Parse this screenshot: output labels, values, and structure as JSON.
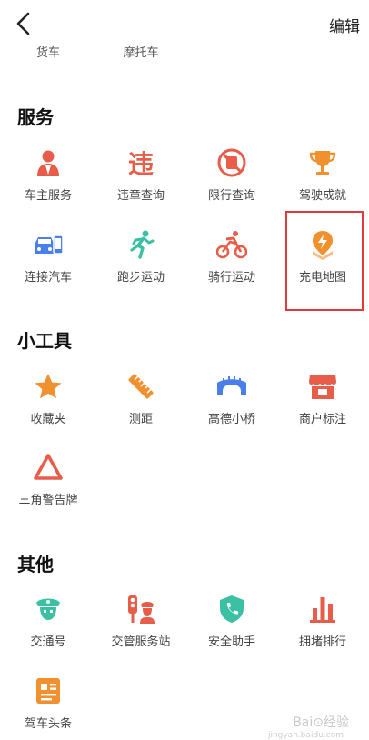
{
  "header": {
    "edit_label": "编辑"
  },
  "top_row": [
    "货车",
    "摩托车"
  ],
  "sections": {
    "services": {
      "title": "服务",
      "items": [
        "车主服务",
        "违章查询",
        "限行查询",
        "驾驶成就",
        "连接汽车",
        "跑步运动",
        "骑行运动",
        "充电地图"
      ]
    },
    "tools": {
      "title": "小工具",
      "items": [
        "收藏夹",
        "测距",
        "高德小桥",
        "商户标注",
        "三角警告牌"
      ]
    },
    "others": {
      "title": "其他",
      "items": [
        "交通号",
        "交管服务站",
        "安全助手",
        "拥堵排行",
        "驾车头条"
      ]
    }
  },
  "violation_glyph": "违",
  "watermark": {
    "text": "Bai⊙经验",
    "sub": "jingyan.baidu.com"
  },
  "colors": {
    "red": "#e85d4a",
    "orange": "#f0902e",
    "blue": "#4a7ee8",
    "teal": "#3cc0a4",
    "highlight": "#e23a3a"
  }
}
